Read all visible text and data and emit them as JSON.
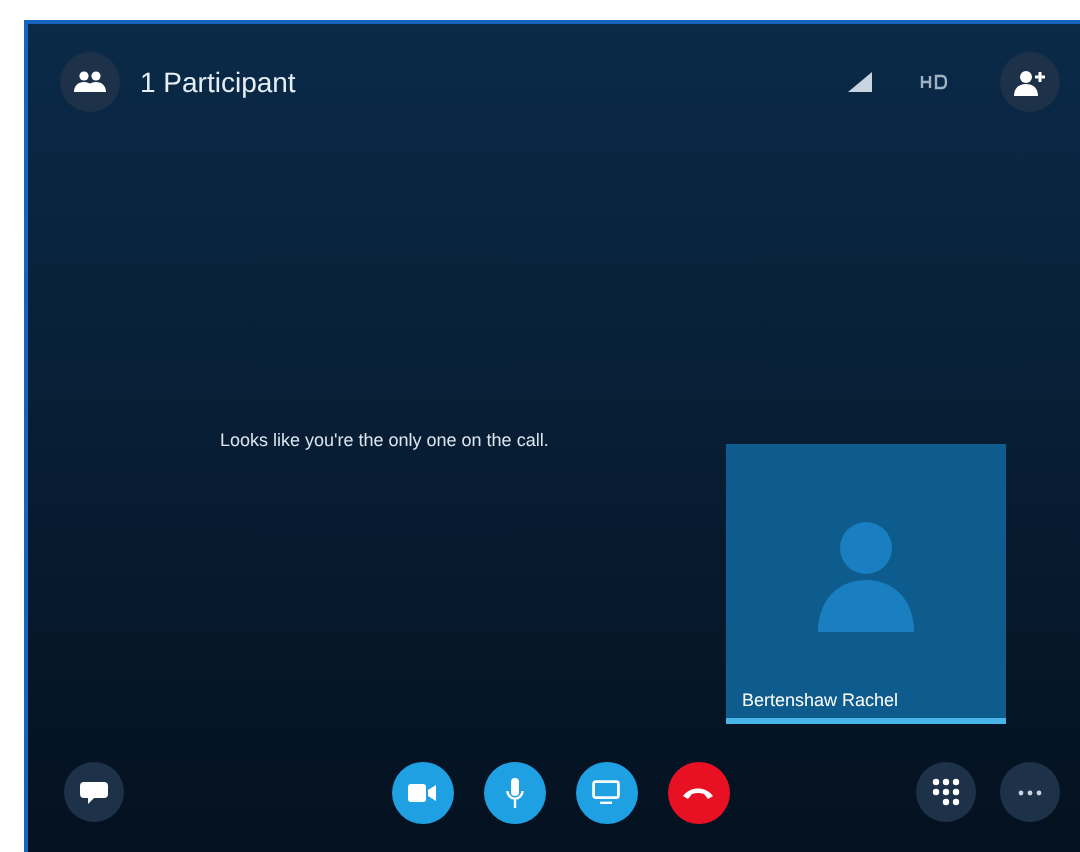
{
  "header": {
    "title": "1 Participant"
  },
  "message": "Looks like you're the only one on the call.",
  "self_view": {
    "name": "Bertenshaw Rachel"
  },
  "call_controls": [
    {
      "kind": "video"
    },
    {
      "kind": "mic"
    },
    {
      "kind": "screen"
    },
    {
      "kind": "hangup"
    }
  ]
}
